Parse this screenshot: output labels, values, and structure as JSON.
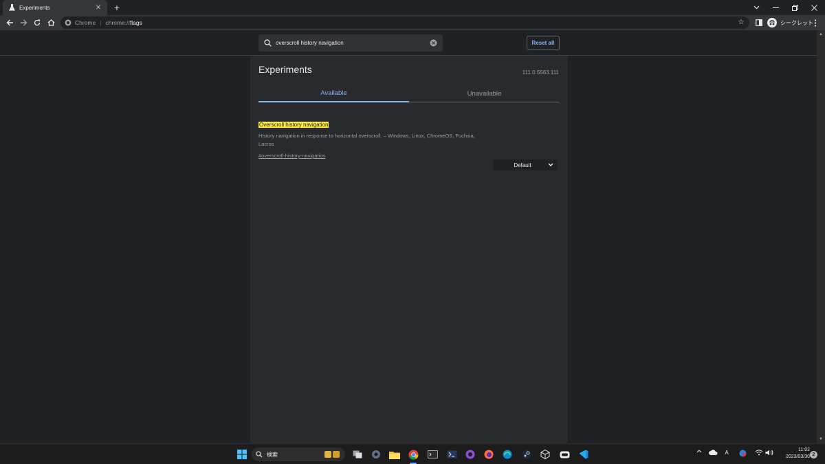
{
  "browser": {
    "tab_title": "Experiments",
    "tab_favicon": "flask-icon",
    "new_tab": "+",
    "address": {
      "scheme": "Chrome",
      "host": "chrome://",
      "path": "flags"
    },
    "profile_label": "シークレット",
    "window_controls": [
      "chevron-down-icon",
      "minimize-icon",
      "restore-icon",
      "close-icon"
    ]
  },
  "flags_page": {
    "search_value": "overscroll history navigation",
    "reset_all_label": "Reset all",
    "title": "Experiments",
    "version": "111.0.5563.111",
    "tabs": [
      {
        "label": "Available",
        "active": true
      },
      {
        "label": "Unavailable",
        "active": false
      }
    ],
    "flag": {
      "name": "Overscroll history navigation",
      "description": "History navigation in response to horizontal overscroll. – Windows, Linux, ChromeOS, Fuchsia, Lacros",
      "link": "#overscroll-history-navigation",
      "selected": "Default"
    }
  },
  "taskbar": {
    "search_label": "検索",
    "time": "11:02",
    "date": "2023/03/30",
    "notification_count": "2",
    "ime_label": "A",
    "accent_color": "#5ea1ff"
  }
}
